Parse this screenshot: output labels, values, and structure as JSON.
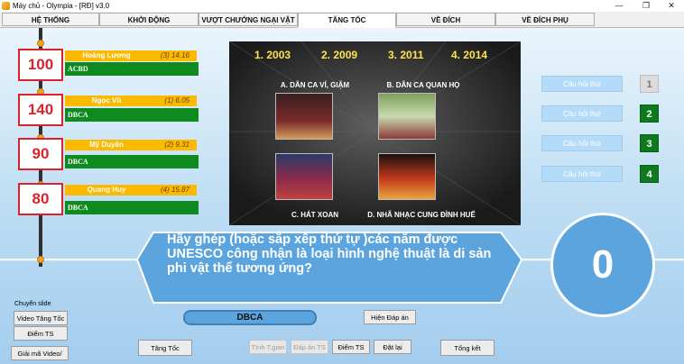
{
  "window": {
    "title": "Máy chủ - Olympia - [RĐ] v3.0",
    "minimize": "—",
    "restore": "❐",
    "close": "✕"
  },
  "tabs": [
    {
      "label": "HỆ THỐNG"
    },
    {
      "label": "KHỞI ĐỘNG"
    },
    {
      "label": "VƯỢT CHƯỚNG NGẠI VẬT"
    },
    {
      "label": "TĂNG TỐC"
    },
    {
      "label": "VỀ ĐÍCH"
    },
    {
      "label": "VỀ ĐÍCH PHỤ"
    }
  ],
  "players": [
    {
      "score": "100",
      "name": "Hoàng Lương",
      "time": "(3)  14.16",
      "answer": "ACBD"
    },
    {
      "score": "140",
      "name": "Ngọc Vũ",
      "time": "(1)  6.05",
      "answer": "DBCA"
    },
    {
      "score": "90",
      "name": "Mỹ Duyên",
      "time": "(2)  9.31",
      "answer": "DBCA"
    },
    {
      "score": "80",
      "name": "Quang Huy",
      "time": "(4)  15.87",
      "answer": "DBCA"
    }
  ],
  "media": {
    "years": [
      "1. 2003",
      "2. 2009",
      "3. 2011",
      "4. 2014"
    ],
    "captions": {
      "a": "A. DÂN CA VÍ, GIẶM",
      "b": "B. DÂN CA QUAN HỌ",
      "c": "C. HÁT XOAN",
      "d": "D. NHÃ NHẠC CUNG ĐÌNH HUẾ"
    }
  },
  "question_buttons": [
    {
      "label": "Câu hỏi thứ",
      "number": "1",
      "active": false
    },
    {
      "label": "Câu hỏi thứ",
      "number": "2",
      "active": true
    },
    {
      "label": "Câu hỏi thứ",
      "number": "3",
      "active": true
    },
    {
      "label": "Câu hỏi thứ",
      "number": "4",
      "active": true
    }
  ],
  "question_text": "Hãy ghép (hoặc sắp xếp thứ tự )các năm được UNESCO công nhận là loại hình nghệ thuật là di sản phi vật thể tương ứng?",
  "timer": "0",
  "correct_answer": "DBCA",
  "controls": {
    "show_answer": "Hiện Đáp án",
    "slide_label": "Chuyển slide",
    "video_tang_toc": "Video Tăng Tốc",
    "diem_ts": "Điểm TS",
    "giai_ma": "Giải mã Video/Ảnh",
    "tang_toc": "Tăng Tốc",
    "tinh_t_gian": "Tính T.gian",
    "dap_an_ts": "Đáp án TS",
    "diem_ts2": "Điểm TS",
    "dat_lai": "Đặt lại",
    "tong_ket": "Tổng kết"
  },
  "colors": {
    "score_border": "#d8232a",
    "name_bar": "#fbb900",
    "answer_bar": "#0f8a1f",
    "accent_blue": "#5ba4de"
  }
}
